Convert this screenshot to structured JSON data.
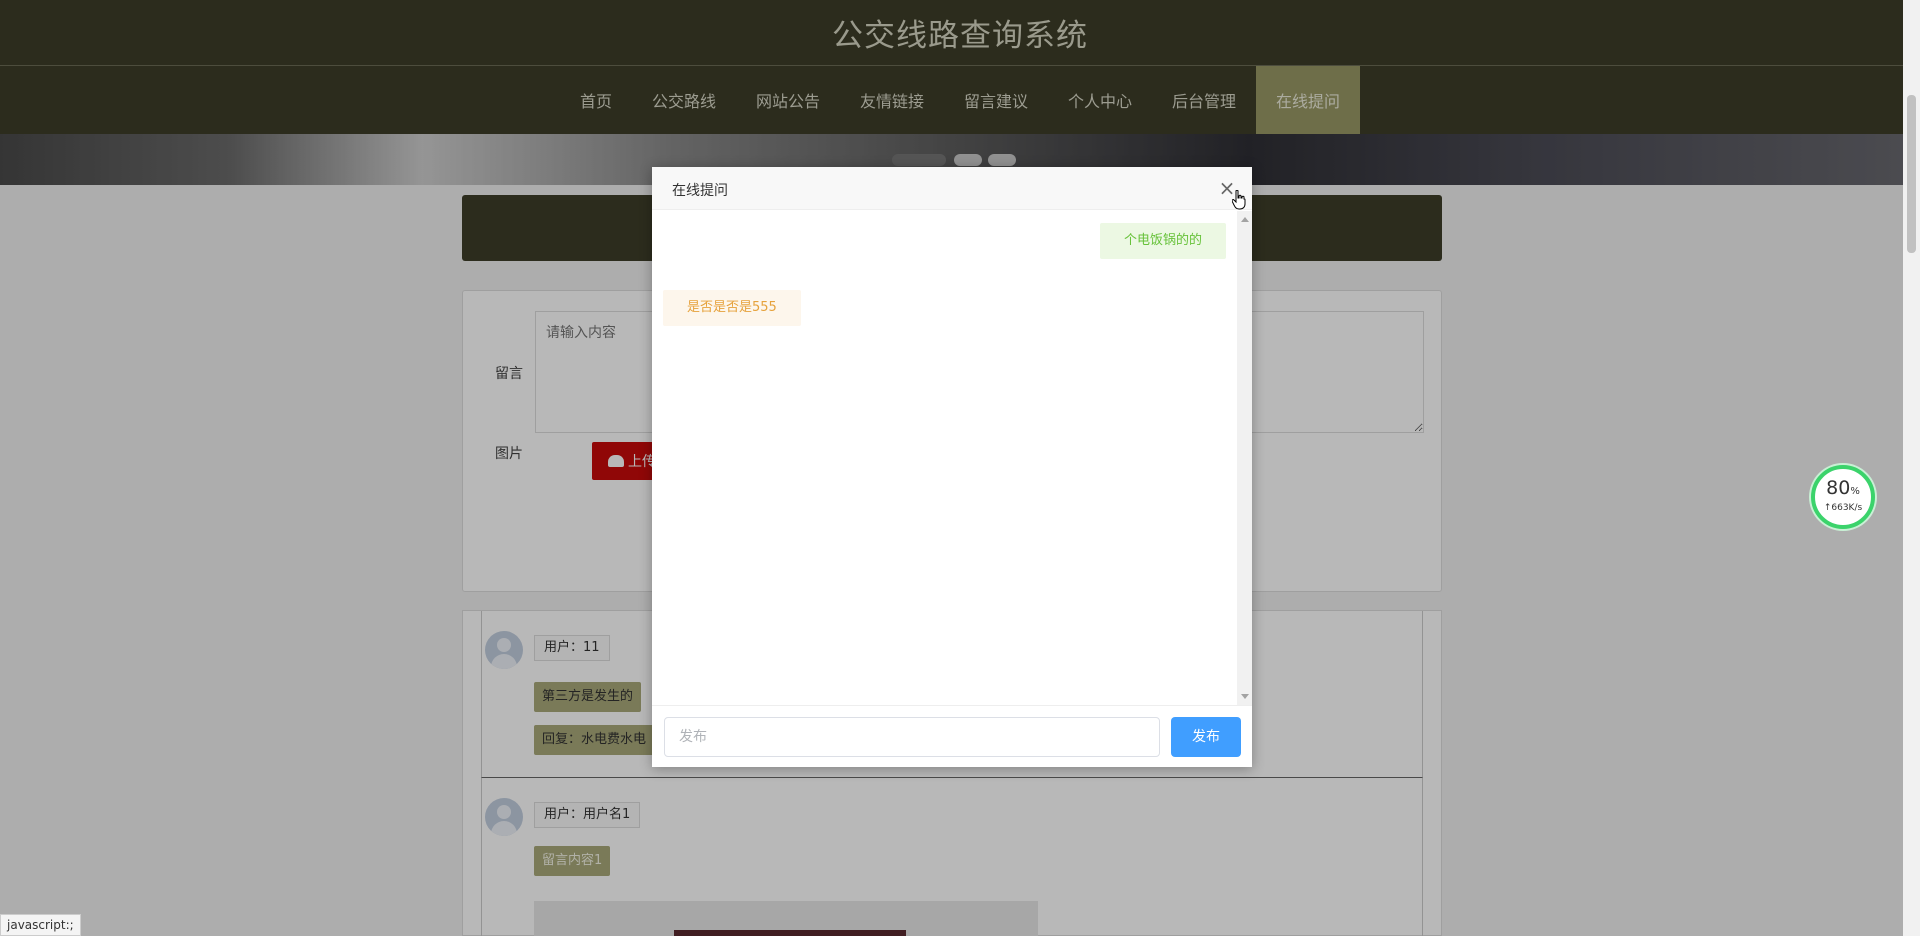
{
  "header": {
    "title": "公交线路查询系统"
  },
  "nav": {
    "items": [
      {
        "label": "首页"
      },
      {
        "label": "公交路线"
      },
      {
        "label": "网站公告"
      },
      {
        "label": "友情链接"
      },
      {
        "label": "留言建议"
      },
      {
        "label": "个人中心"
      },
      {
        "label": "后台管理"
      },
      {
        "label": "在线提问",
        "active": true
      }
    ]
  },
  "form": {
    "message_label": "留言",
    "message_placeholder": "请输入内容",
    "image_label": "图片",
    "upload_label": "上传"
  },
  "comments": [
    {
      "user": "用户：11",
      "content": "第三方是发生的",
      "reply": "回复：水电费水电"
    },
    {
      "user": "用户：用户名1",
      "content": "留言内容1"
    }
  ],
  "dialog": {
    "title": "在线提问",
    "messages": [
      {
        "side": "right",
        "text": "个电饭锅的的"
      },
      {
        "side": "left",
        "text": "是否是否是555"
      }
    ],
    "input_placeholder": "发布",
    "send_label": "发布"
  },
  "speed_widget": {
    "percent": "80",
    "percent_unit": "%",
    "rate": "↑663K/s"
  },
  "status_bar": {
    "text": "javascript:;"
  },
  "colors": {
    "header_bg": "#3d3d29",
    "nav_active_bg": "#999966",
    "upload_red": "#c80a0a",
    "send_blue": "#409eff",
    "bubble_right_text": "#67c23a",
    "bubble_left_text": "#e6a23c"
  },
  "icons": {
    "close": "close-icon",
    "upload": "cloud-upload-icon",
    "avatar": "user-avatar-icon"
  }
}
